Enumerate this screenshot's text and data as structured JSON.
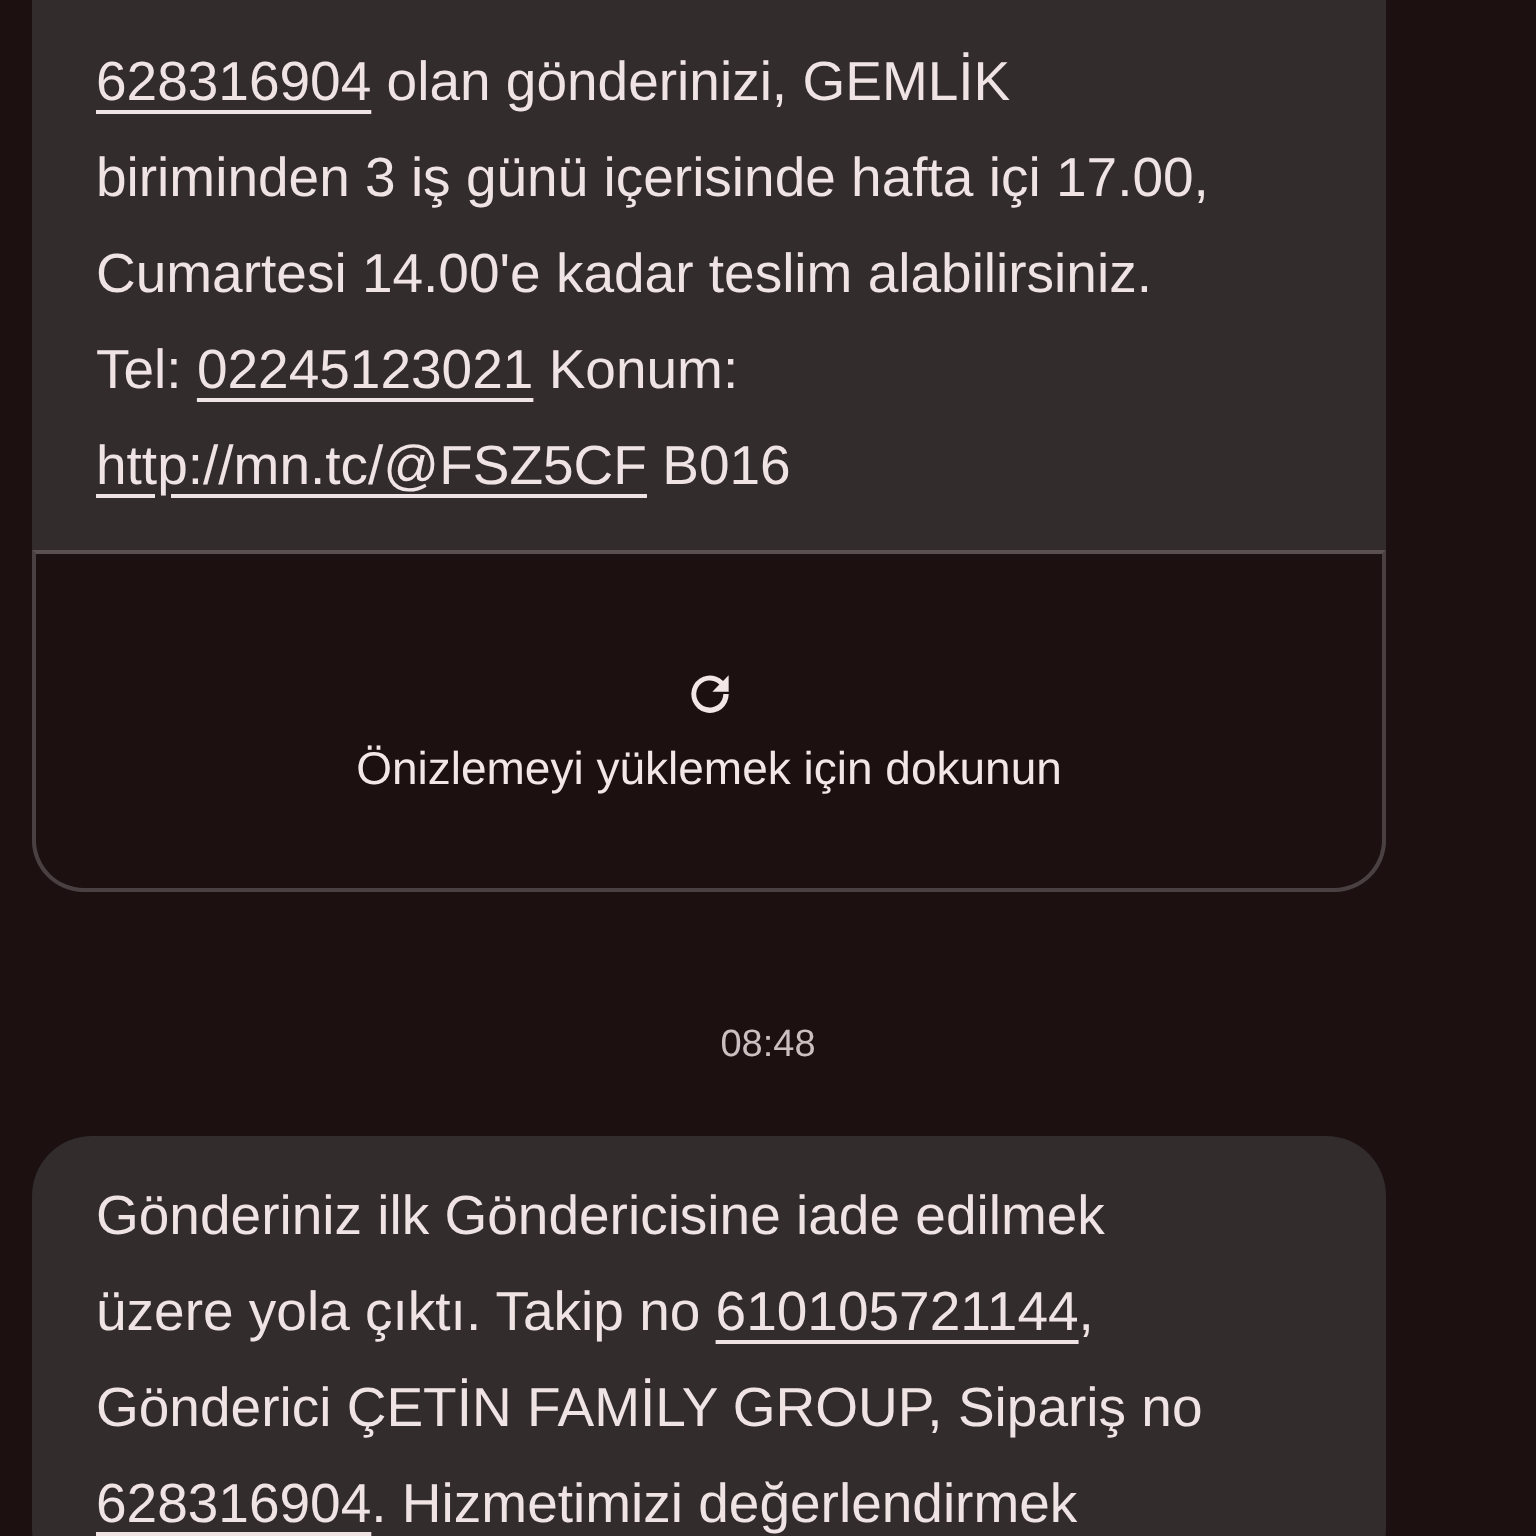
{
  "messages": [
    {
      "kind": "bubble",
      "segments": [
        {
          "text": "628316904",
          "link": true
        },
        {
          "text": " olan gönderinizi, GEMLİK biriminden 3 iş günü içerisinde hafta içi 17.00, Cumartesi 14.00'e kadar teslim alabilirsiniz. Tel: ",
          "link": false
        },
        {
          "text": "02245123021",
          "link": true
        },
        {
          "text": " Konum: ",
          "link": false
        },
        {
          "text": "http://mn.tc/@FSZ5CF",
          "link": true
        },
        {
          "text": " B016",
          "link": false
        }
      ],
      "preview": {
        "label": "Önizlemeyi yüklemek için dokunun"
      }
    },
    {
      "kind": "timestamp",
      "text": "08:48"
    },
    {
      "kind": "bubble",
      "segments": [
        {
          "text": "Gönderiniz ilk Göndericisine iade edilmek üzere yola çıktı. Takip no ",
          "link": false
        },
        {
          "text": "610105721144",
          "link": true
        },
        {
          "text": ", Gönderici ÇETİN FAMİLY GROUP, Sipariş no ",
          "link": false
        },
        {
          "text": "628316904",
          "link": true
        },
        {
          "text": ". Hizmetimizi değerlendirmek",
          "link": false
        }
      ]
    }
  ]
}
